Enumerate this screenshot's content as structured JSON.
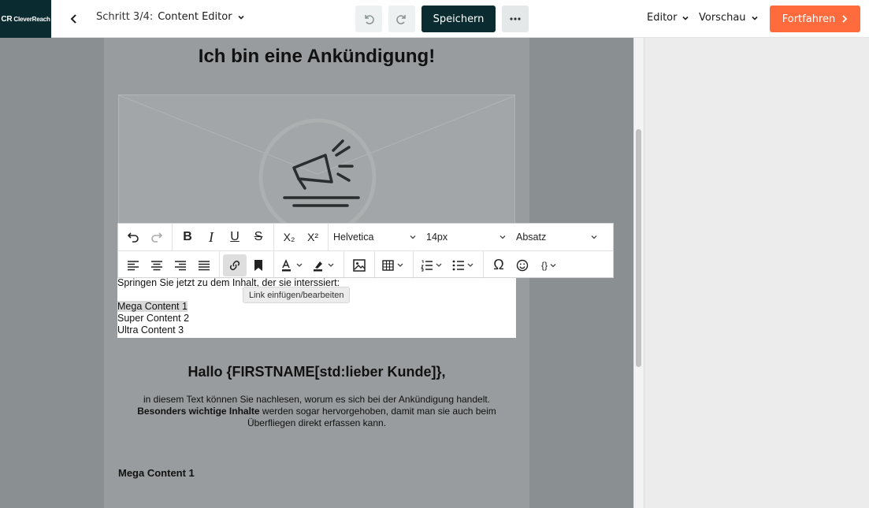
{
  "header": {
    "logo_text": "CleverReach",
    "step_prefix": "Schritt 3/4:",
    "step_name": "Content Editor",
    "save_label": "Speichern",
    "editor_label": "Editor",
    "preview_label": "Vorschau",
    "continue_label": "Fortfahren"
  },
  "icons": {
    "back": "chevron-left-icon",
    "undo": "undo-icon",
    "redo": "redo-icon",
    "more": "ellipsis-icon"
  },
  "colors": {
    "primary_dark": "#0a2b2f",
    "accent": "#ff6b3d"
  },
  "content": {
    "heading": "Ich bin eine Ankündigung!",
    "text_lines": [
      "Springen Sie jetzt zu dem Inhalt, der sie interssiert:",
      "Mega Content 1",
      "Super Content 2",
      "Ultra Content 3"
    ],
    "greeting": "Hallo {FIRSTNAME[std:lieber Kunde]},",
    "paragraph_line1": "in diesem Text können Sie nachlesen, worum es sich bei der Ankündigung handelt.",
    "paragraph_bold": "Besonders wichtige Inhalte",
    "paragraph_rest": " werden sogar hervorgehoben, damit man sie auch beim",
    "paragraph_line3": "Überfliegen direkt erfassen kann.",
    "section_title": "Mega Content 1"
  },
  "toolbar": {
    "font_family": "Helvetica",
    "font_size": "14px",
    "block_format": "Absatz",
    "subscript_label": "X₂",
    "superscript_label": "X²",
    "bold_label": "B",
    "italic_label": "I",
    "underline_label": "U",
    "strike_label": "S",
    "special_char_label": "Ω",
    "code_label": "{}",
    "tooltip": "Link einfügen/bearbeiten"
  }
}
